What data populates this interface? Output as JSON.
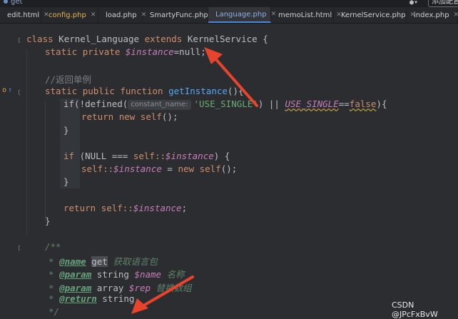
{
  "top": {
    "breadcrumb": "get",
    "add_button": "添加配置"
  },
  "tabs": [
    {
      "label": "edit.html",
      "color": "#d9822b"
    },
    {
      "label": "config.php",
      "color": "#a7a35a",
      "vcs": true
    },
    {
      "label": "load.php",
      "color": "#7f88c6"
    },
    {
      "label": "SmartyFunc.php",
      "color": "#7f88c6"
    },
    {
      "label": "Language.php",
      "color": "#7f88c6",
      "active": true
    },
    {
      "label": "memoList.html",
      "color": "#5fa55a"
    },
    {
      "label": "KernelService.php",
      "color": "#4a88e0"
    },
    {
      "label": "index.php",
      "color": "#7f88c6"
    }
  ],
  "code": {
    "l1": [
      "class",
      "Kernel_Language",
      "extends",
      "KernelService",
      "{"
    ],
    "l2": [
      "static",
      "private",
      "$instance",
      "=null;"
    ],
    "l4": "//返回单例",
    "l5": [
      "static",
      "public",
      "function",
      "getInstance",
      "(){"
    ],
    "l6": [
      "if(!defined(",
      "constant_name:",
      "'USE_SINGLE'",
      ") || ",
      "USE_SINGLE",
      "==",
      "false",
      "){"
    ],
    "l7": [
      "return",
      "new",
      "self",
      "();"
    ],
    "l8": "}",
    "l10": [
      "if",
      "(NULL === ",
      "self::",
      "$instance",
      ") {"
    ],
    "l11": [
      "self::",
      "$instance",
      " = ",
      "new",
      "self",
      "();"
    ],
    "l12": "}",
    "l14": [
      "return",
      "self::",
      "$instance",
      ";"
    ],
    "l15": "}",
    "l17": "/**",
    "l18": [
      "* ",
      "@name",
      "get",
      "获取语言包"
    ],
    "l19": [
      "* ",
      "@param",
      "string",
      "$name",
      "名称"
    ],
    "l20": [
      "* ",
      "@param",
      "array",
      "$rep",
      "替换数组"
    ],
    "l21": [
      "* ",
      "@return",
      "string"
    ],
    "l22": "*/"
  },
  "watermark": "CSDN @JPcFxBvW",
  "colors": {
    "arrow": "#e8432d",
    "keyword": "#cf8e6d",
    "variable": "#c77dbb",
    "function": "#56a8f5",
    "string": "#6aab73"
  }
}
